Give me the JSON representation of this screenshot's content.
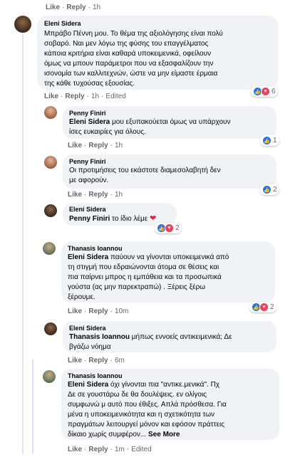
{
  "top_actions": {
    "like": "Like",
    "reply": "Reply",
    "time": "1h"
  },
  "c1": {
    "name": "Eleni Sidera",
    "lines": [
      "Μπράβο Πέννη μου. Το θέμα της αξιολόγησης είναι πολύ",
      "σοβαρό. Ναι μεν λόγω της φύσης του επαγγέλματος",
      "κάποια κριτήρια είναι καθαρά υποκειμενικά, οφείλουν",
      "όμως να μπουν παράμετροι που να εξασφαλίζουν την",
      "ισονομία των καλλιτεχνών, ώστε να μην είμαστε έρμαια",
      "της κάθε τυχούσας εξουσίας."
    ],
    "like": "Like",
    "reply": "Reply",
    "time": "1h",
    "edited": "Edited",
    "react_count": "6"
  },
  "c2": {
    "name": "Penny Finiri",
    "tag": "Eleni Sidera",
    "lines": [
      " μου εξυπακούεται όμως να υπάρχουν",
      "ίσες ευκαιρίες για όλους."
    ],
    "like": "Like",
    "reply": "Reply",
    "time": "1h",
    "react_count": "1"
  },
  "c3": {
    "name": "Penny Finiri",
    "lines": [
      "Οι προτιμήσεις του εκάστοτε διαμεσολαβητή δεν",
      "με αφορούν."
    ],
    "like": "Like",
    "reply": "Reply",
    "time": "1h",
    "react_count": "2"
  },
  "c4": {
    "name": "Eleni Sidera",
    "tag": "Penny Finiri",
    "text": " το ίδιο λέμε ",
    "heart": "❤",
    "react_count": "2"
  },
  "c5": {
    "name": "Thanasis Ioannou",
    "tag": "Eleni Sidera",
    "lines": [
      " παύουν να γίνονται υποκειμενικά από",
      "τη στιγμή που εδραιώνονται άτομα σε θέσεις και",
      "πια παίρνει μπρος η εμπάθεια και τα προσωπικά",
      "γούστα (ας μην παρεκτραπώ) . Ξέρεις ξέρω",
      "ξέρουμε."
    ],
    "like": "Like",
    "reply": "Reply",
    "time": "10m",
    "react_count": "2"
  },
  "c6": {
    "name": "Eleni Sidera",
    "tag": "Thanasis Ioannou",
    "lines": [
      " μήπως εννοείς αντικειμενικά; Δε",
      "βγάζω νόημα"
    ],
    "like": "Like",
    "reply": "Reply",
    "time": "6m"
  },
  "c7": {
    "name": "Thanasis Ioannou",
    "tag": "Eleni Sidera",
    "lines": [
      " όχι γίνονται πια \"αντικε.μενικά\". Πχ",
      "Δε σε γουστάρω δε θα δουλέψεις. εν ολίγοις",
      "συμφωνώ μ αυτό που έθιξες. Απλά πρόσθεσα. Για",
      "μένα η υποκειμενικότητα και η σχετικότητα των",
      "πραγμάτων λειτουργεί μόνον και εφόσον πράττεις",
      "δίκαιο χωρίς συμφέρον..."
    ],
    "see_more": "See More",
    "like": "Like",
    "reply": "Reply",
    "time": "1m",
    "edited": "Edited"
  },
  "icons": {
    "like": "like-icon",
    "love": "love-icon"
  }
}
